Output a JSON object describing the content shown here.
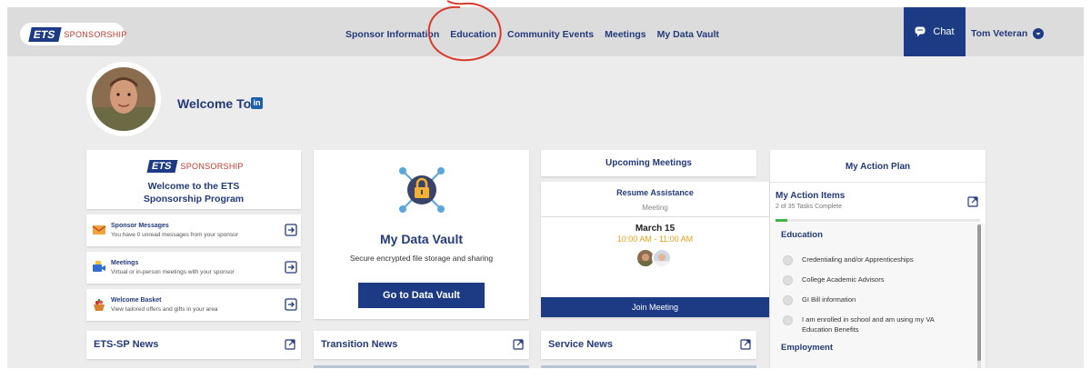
{
  "navbar": {
    "logo_ets": "ETS",
    "logo_sponsorship": "SPONSORSHIP",
    "links": [
      "Sponsor Information",
      "Education",
      "Community Events",
      "Meetings",
      "My Data Vault"
    ],
    "chat_label": "Chat",
    "user_name": "Tom Veteran"
  },
  "profile": {
    "welcome": "Welcome Tom",
    "linkedin_glyph": "in"
  },
  "welcome_card": {
    "logo_ets": "ETS",
    "logo_sponsorship": "SPONSORSHIP",
    "title": "Welcome to the ETS Sponsorship Program"
  },
  "messages": [
    {
      "title": "Sponsor Messages",
      "subtitle": "You have 0 unread messages from your sponsor",
      "icon": "envelope-icon"
    },
    {
      "title": "Meetings",
      "subtitle": "Virtual or in-person meetings with your sponsor",
      "icon": "video-camera-icon"
    },
    {
      "title": "Welcome Basket",
      "subtitle": "View tailored offers and gifts in your area",
      "icon": "gift-basket-icon"
    }
  ],
  "data_vault": {
    "title": "My Data Vault",
    "description": "Secure encrypted file storage and sharing",
    "button": "Go to Data Vault"
  },
  "meetings": {
    "header": "Upcoming Meetings",
    "title": "Resume Assistance",
    "type": "Meeting",
    "date": "March 15",
    "time": "10:00 AM - 11:00 AM",
    "join_button": "Join Meeting"
  },
  "action_plan": {
    "title": "My Action Plan",
    "items_title": "My Action Items",
    "progress_text": "2 of 35 Tasks Complete",
    "progress_fraction": 0.057,
    "categories": [
      {
        "name": "Education",
        "tasks": [
          "Credentialing and/or Apprenticeships",
          "College Academic Advisors",
          "GI Bill information",
          "I am enrolled in school and am using my VA Education Benefits"
        ]
      },
      {
        "name": "Employment",
        "tasks": []
      }
    ]
  },
  "news": [
    {
      "title": "ETS-SP News"
    },
    {
      "title": "Transition News"
    },
    {
      "title": "Service News"
    }
  ],
  "colors": {
    "brand_navy": "#1d3b84",
    "accent_red": "#c0392b",
    "time_orange": "#e8a21b",
    "progress_green": "#42b549"
  }
}
